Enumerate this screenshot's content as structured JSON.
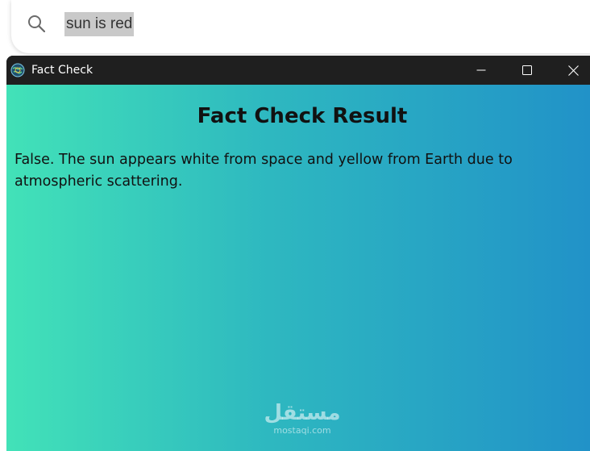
{
  "background_search": {
    "query": "sun is red",
    "icon": "search-icon"
  },
  "window": {
    "title": "Fact Check",
    "icon": "globe-app-icon",
    "controls": [
      "minimize-icon",
      "maximize-icon",
      "close-icon"
    ]
  },
  "result": {
    "heading": "Fact Check Result",
    "body": "False. The sun appears white from space and yellow from Earth due to atmospheric scattering."
  },
  "watermark": {
    "logo": "مستقل",
    "url": "mostaqi.com"
  },
  "colors": {
    "titlebar": "#1f1f1f",
    "gradient_start": "#42e2b8",
    "gradient_end": "#2192c8",
    "text": "#111111",
    "search_highlight": "#c9c9c9"
  }
}
